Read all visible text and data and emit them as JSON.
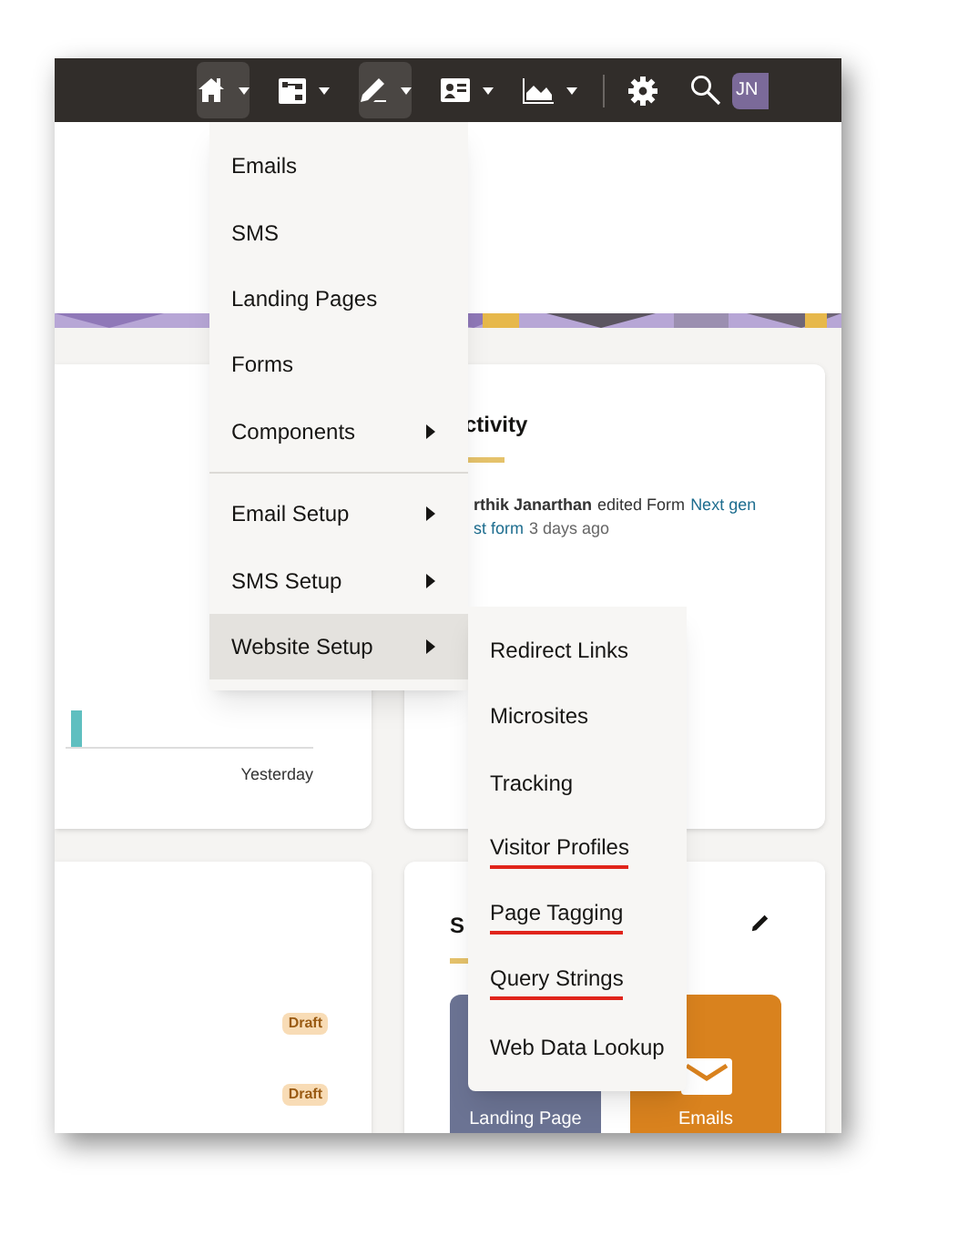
{
  "top_bar": {
    "buttons": [
      {
        "kind": "home",
        "selected": true
      },
      {
        "kind": "flow",
        "selected": false
      },
      {
        "kind": "pencil",
        "selected": true
      },
      {
        "kind": "contact",
        "selected": false
      },
      {
        "kind": "chart",
        "selected": false
      }
    ],
    "avatar": "JN"
  },
  "chart_card": {
    "x_label": "Yesterday"
  },
  "activity_card": {
    "title": "ctivity",
    "actor": "rthik Janarthan",
    "action": "edited Form",
    "link_parts": [
      "Next gen",
      "st form"
    ],
    "time": "3 days ago"
  },
  "list_card": {
    "badges": [
      "Draft",
      "Draft"
    ]
  },
  "shortcuts_card": {
    "title": "S",
    "tiles": [
      {
        "label": "Landing Page",
        "color": "#6b7393",
        "kind": "plain"
      },
      {
        "label": "Emails",
        "color": "#d9821e",
        "kind": "envelope"
      }
    ]
  },
  "menu": {
    "items": [
      {
        "label": "Emails",
        "has_submenu": false,
        "selected": false
      },
      {
        "label": "SMS",
        "has_submenu": false,
        "selected": false
      },
      {
        "label": "Landing Pages",
        "has_submenu": false,
        "selected": false
      },
      {
        "label": "Forms",
        "has_submenu": false,
        "selected": false
      },
      {
        "label": "Components",
        "has_submenu": true,
        "selected": false
      },
      {
        "kind": "divider"
      },
      {
        "label": "Email Setup",
        "has_submenu": true,
        "selected": false
      },
      {
        "label": "SMS Setup",
        "has_submenu": true,
        "selected": false
      },
      {
        "label": "Website Setup",
        "has_submenu": true,
        "selected": true
      }
    ]
  },
  "submenu": {
    "items": [
      {
        "label": "Redirect Links",
        "underlined": false
      },
      {
        "label": "Microsites",
        "underlined": false
      },
      {
        "label": "Tracking",
        "underlined": false
      },
      {
        "label": "Visitor Profiles",
        "underlined": true
      },
      {
        "label": "Page Tagging",
        "underlined": true
      },
      {
        "label": "Query Strings",
        "underlined": true
      },
      {
        "label": "Web Data Lookup",
        "underlined": false
      }
    ]
  }
}
